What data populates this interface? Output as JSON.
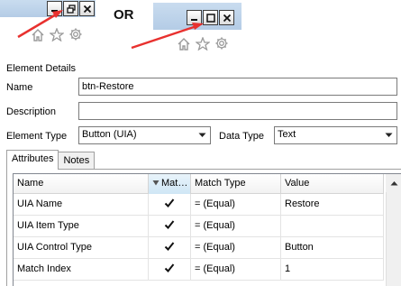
{
  "illustration": {
    "or_label": "OR",
    "restore_variant_icons": [
      "minimize-icon",
      "restore-icon",
      "close-icon"
    ],
    "maximize_variant_icons": [
      "minimize-icon",
      "maximize-icon",
      "close-icon"
    ],
    "arrow_color": "#e8312f"
  },
  "element_details": {
    "section_title": "Element Details",
    "name_label": "Name",
    "name_value": "btn-Restore",
    "description_label": "Description",
    "description_value": "",
    "element_type_label": "Element Type",
    "element_type_value": "Button (UIA)",
    "data_type_label": "Data Type",
    "data_type_value": "Text"
  },
  "tabs": [
    {
      "label": "Attributes",
      "active": true
    },
    {
      "label": "Notes",
      "active": false
    }
  ],
  "grid": {
    "columns": [
      "Name",
      "Mat…",
      "Match Type",
      "Value"
    ],
    "rows": [
      {
        "name": "UIA Name",
        "match": true,
        "match_type": "=  (Equal)",
        "value": "Restore"
      },
      {
        "name": "UIA Item Type",
        "match": true,
        "match_type": "=  (Equal)",
        "value": ""
      },
      {
        "name": "UIA Control Type",
        "match": true,
        "match_type": "=  (Equal)",
        "value": "Button"
      },
      {
        "name": "Match Index",
        "match": true,
        "match_type": "=  (Equal)",
        "value": "1"
      }
    ]
  }
}
